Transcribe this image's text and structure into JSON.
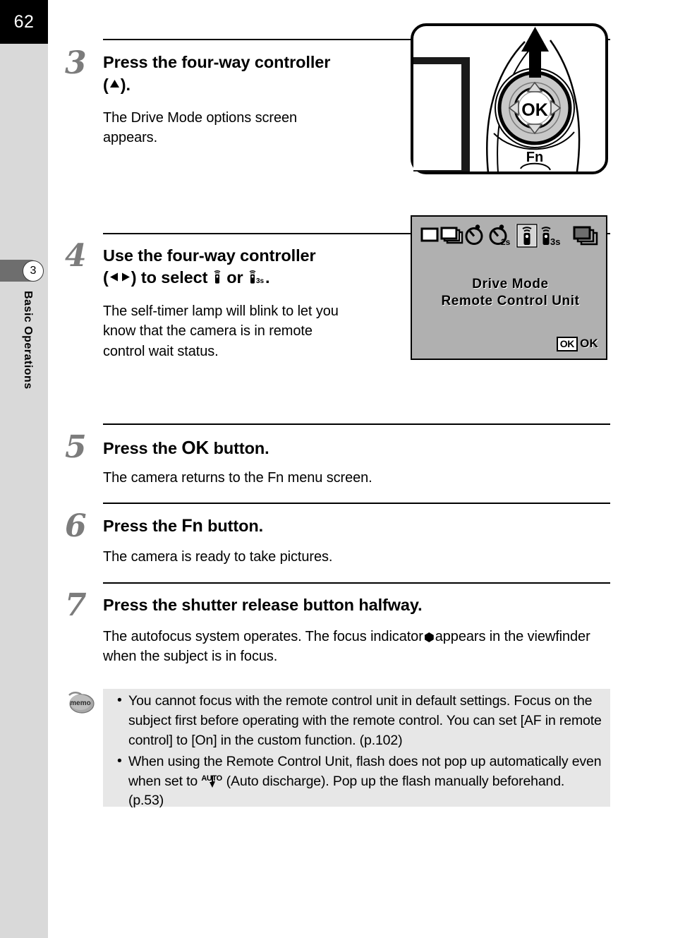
{
  "page": {
    "number": "62",
    "chapter_number": "3",
    "chapter_label": "Basic Operations"
  },
  "steps": [
    {
      "number": "3",
      "heading_line1": "Press the four-way controller",
      "heading_line2_prefix": "(",
      "heading_line2_icon": "up-triangle",
      "heading_line2_suffix": ").",
      "body_line1": "The Drive Mode options screen",
      "body_line2": "appears."
    },
    {
      "number": "4",
      "heading_line1": "Use the four-way controller",
      "heading_line2_prefix": "(",
      "heading_line2_icons": "left-triangle right-triangle",
      "heading_line2_mid": ") to select",
      "heading_line2_or": "or",
      "heading_line2_suffix": ".",
      "body_line1": "The self-timer lamp will blink to let you",
      "body_line2": "know that the camera is in remote",
      "body_line3": "control wait status."
    },
    {
      "number": "5",
      "heading_prefix": "Press the",
      "heading_button": "OK",
      "heading_suffix": "button.",
      "body_line1": "The camera returns to the Fn menu screen."
    },
    {
      "number": "6",
      "heading_prefix": "Press the",
      "heading_button": "Fn",
      "heading_suffix": "button.",
      "body_line1": "The camera is ready to take pictures."
    },
    {
      "number": "7",
      "heading_full": "Press the shutter release button halfway.",
      "body_part1": "The autofocus system operates. The focus indicator",
      "body_part2": "appears in the",
      "body_line2": "viewfinder when the subject is in focus."
    }
  ],
  "camera_illustration": {
    "ok_button_label": "OK",
    "fn_button_label": "Fn",
    "arrow_direction": "up"
  },
  "lcd_screen": {
    "title": "Drive Mode",
    "subtitle": "Remote Control Unit",
    "ok_box_label": "OK",
    "ok_text_label": "OK",
    "selected_index": 4,
    "icons": [
      {
        "name": "single-frame-icon",
        "sublabel": ""
      },
      {
        "name": "continuous-shooting-icon",
        "sublabel": ""
      },
      {
        "name": "self-timer-12s-icon",
        "sublabel": ""
      },
      {
        "name": "self-timer-2s-icon",
        "sublabel": "2s"
      },
      {
        "name": "remote-control-icon",
        "sublabel": ""
      },
      {
        "name": "remote-control-3s-icon",
        "sublabel": "3s"
      },
      {
        "name": "exposure-bracketing-icon",
        "sublabel": ""
      }
    ]
  },
  "memo": {
    "icon_label": "memo",
    "bullet": "•",
    "items": [
      "You cannot focus with the remote control unit in default settings. Focus on the subject first before operating with the remote control. You can set [AF in remote control] to [On] in the custom function. (p.102)"
    ],
    "item2_part1": "When using the Remote Control Unit, flash does not pop up automatically even when set to",
    "item2_part2": "(Auto discharge). Pop up the flash manually beforehand. (p.53)"
  },
  "colors": {
    "sidebar_bg": "#d9d9d9",
    "page_block_bg": "#000000",
    "chapter_tab_bg": "#6e6e6e",
    "step_number": "#7c7c7c",
    "lcd_bg": "#b0b0b0",
    "memo_bg": "#e7e7e7"
  }
}
